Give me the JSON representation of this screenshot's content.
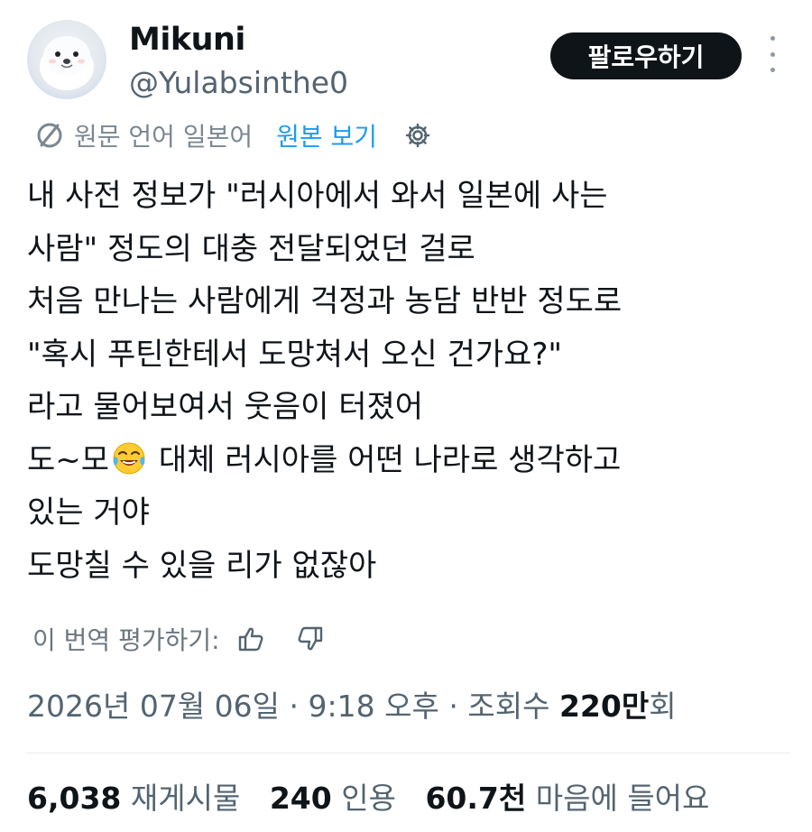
{
  "author": {
    "display_name": "Mikuni",
    "handle": "@Yulabsinthe0",
    "follow_label": "팔로우하기"
  },
  "translation": {
    "source_language": "원문 언어 일본어",
    "show_original_label": "원본 보기",
    "rate_label": "이 번역 평가하기:"
  },
  "tweet": {
    "lines": [
      "내 사전 정보가 \"러시아에서 와서 일본에 사는",
      "사람\" 정도의 대충 전달되었던 걸로",
      "처음 만나는 사람에게 걱정과 농담 반반 정도로",
      "\"혹시 푸틴한테서 도망쳐서 오신 건가요?\"",
      "라고 물어보여서 웃음이 터졌어",
      "",
      "있는 거야",
      "도망칠 수 있을 리가 없잖아"
    ],
    "line6_before_emoji": "도~모",
    "line6_after_emoji": " 대체 러시아를 어떤 나라로 생각하고",
    "emoji": "face-with-tears-of-joy"
  },
  "meta": {
    "date": "2026년 07월 06일",
    "time": "9:18 오후",
    "views_prefix": "조회수",
    "views_count": "220만",
    "views_suffix": "회",
    "separator": "·"
  },
  "stats": {
    "retweets_count": "6,038",
    "retweets_label": "재게시물",
    "quotes_count": "240",
    "quotes_label": "인용",
    "likes_count": "60.7천",
    "likes_label": "마음에 들어요"
  },
  "colors": {
    "accent": "#1d9bf0",
    "text": "#0f1419",
    "secondary": "#536471",
    "button_bg": "#0f1419"
  }
}
